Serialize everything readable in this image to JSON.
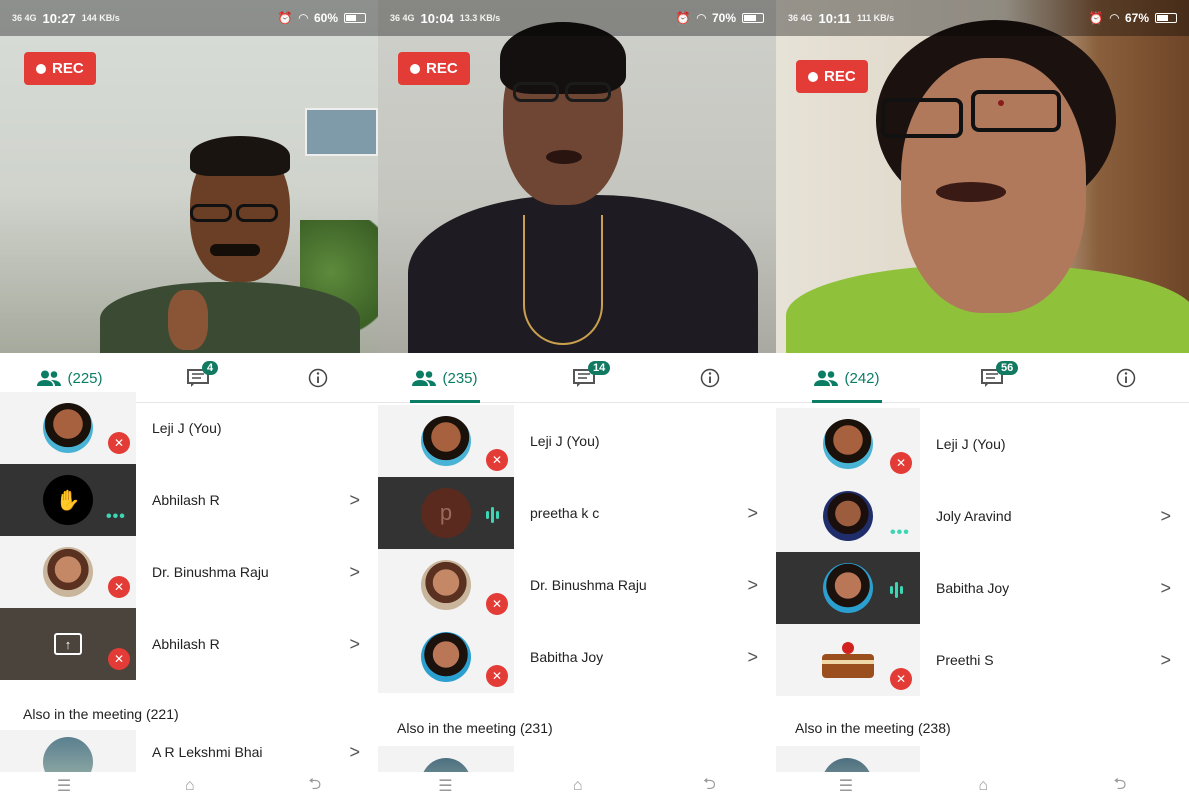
{
  "panels": [
    {
      "status": {
        "signal": "36 4G",
        "time": "10:27",
        "speed": "144 KB/s",
        "battery": "60%"
      },
      "rec_label": "REC",
      "tabs": {
        "people_count": "(225)",
        "chat_badge": "4"
      },
      "participants": [
        {
          "name": "Leji J (You)",
          "chevron": ""
        },
        {
          "name": "Abhilash R",
          "chevron": ">"
        },
        {
          "name": "Dr. Binushma Raju",
          "chevron": ">"
        },
        {
          "name": "Abhilash R",
          "chevron": ">"
        }
      ],
      "also_label": "Also in the meeting (221)",
      "also_first": {
        "name": "A R Lekshmi Bhai",
        "chevron": ">"
      },
      "battery_fraction": 0.6
    },
    {
      "status": {
        "signal": "36 4G",
        "time": "10:04",
        "speed": "13.3 KB/s",
        "battery": "70%"
      },
      "rec_label": "REC",
      "tabs": {
        "people_count": "(235)",
        "chat_badge": "14"
      },
      "participants": [
        {
          "name": "Leji J (You)",
          "chevron": ""
        },
        {
          "name": "preetha k c",
          "chevron": ">",
          "initial": "p"
        },
        {
          "name": "Dr. Binushma Raju",
          "chevron": ">"
        },
        {
          "name": "Babitha Joy",
          "chevron": ">"
        }
      ],
      "also_label": "Also in the meeting (231)",
      "battery_fraction": 0.7
    },
    {
      "status": {
        "signal": "36 4G",
        "time": "10:11",
        "speed": "111 KB/s",
        "battery": "67%"
      },
      "rec_label": "REC",
      "tabs": {
        "people_count": "(242)",
        "chat_badge": "56"
      },
      "participants": [
        {
          "name": "Leji J (You)",
          "chevron": ""
        },
        {
          "name": "Joly Aravind",
          "chevron": ">"
        },
        {
          "name": "Babitha Joy",
          "chevron": ">"
        },
        {
          "name": "Preethi S",
          "chevron": ">"
        }
      ],
      "also_label": "Also in the meeting (238)",
      "battery_fraction": 0.67
    }
  ],
  "nav": {
    "menu": "☰",
    "home": "⌂",
    "back": "⮌"
  },
  "colors": {
    "accent": "#0b7d65",
    "rec": "#e33b36",
    "mute": "#e33b36",
    "speaking": "#3dd6b5"
  },
  "icons": [
    "people-icon",
    "chat-icon",
    "info-icon",
    "mic-off-icon",
    "hand-raise-icon",
    "present-icon",
    "volume-off-icon"
  ]
}
